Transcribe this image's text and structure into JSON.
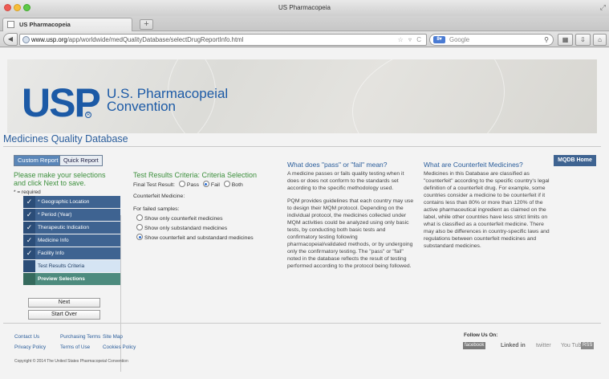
{
  "window": {
    "title": "US Pharmacopeia"
  },
  "tab": {
    "label": "US Pharmacopeia",
    "new_tab": "+"
  },
  "nav": {
    "url_host": "www.usp.org",
    "url_path": "/app/worldwide/medQualityDatabase/selectDrugReportInfo.html",
    "search_placeholder": "Google",
    "search_engine_icon": "google-icon"
  },
  "header": {
    "logo_text": "US",
    "logo_text_p": "P",
    "org_name_line1": "U.S. Pharmacopeial",
    "org_name_line2": "Convention",
    "db_title": "Medicines Quality Database"
  },
  "report_tabs": {
    "custom": "Custom Report",
    "quick": "Quick Report"
  },
  "left_panel": {
    "heading": "Please make your selections and click Next to save.",
    "required_note": "* = required",
    "steps": [
      {
        "label": "* Geographic Location",
        "checked": true
      },
      {
        "label": "* Period (Year)",
        "checked": true
      },
      {
        "label": "Therapeutic Indication",
        "checked": true
      },
      {
        "label": "Medicine Info",
        "checked": true
      },
      {
        "label": "Facility Info",
        "checked": true
      },
      {
        "label": "Test Results Criteria",
        "checked": false
      },
      {
        "label": "Preview Selections",
        "checked": false
      }
    ],
    "next_button": "Next",
    "start_over_button": "Start Over"
  },
  "criteria": {
    "title": "Test Results Criteria: Criteria Selection",
    "final_result_label": "Final Test Result:",
    "final_result_options": [
      "Pass",
      "Fail",
      "Both"
    ],
    "final_result_selected": "Fail",
    "counterfeit_label": "Counterfeit Medicine:",
    "failed_label": "For failed samples:",
    "sample_options": [
      "Show only counterfeit medicines",
      "Show only substandard medicines",
      "Show counterfeit and substandard medicines"
    ],
    "sample_selected": "Show counterfeit and substandard medicines"
  },
  "pass_fail": {
    "heading": "What does \"pass\" or \"fail\" mean?",
    "p1": "A medicine passes or fails quality testing when it does or does not conform to the standards set according to the specific methodology used.",
    "p2": "PQM provides guidelines that each country may use to design their MQM protocol. Depending on the individual protocol, the medicines collected under MQM activities could be analyzed using only basic tests, by conducting both basic tests and confirmatory testing following pharmacopeial/validated methods, or by undergoing only the confirmatory testing. The \"pass\" or \"fail\" noted in the database reflects the result of testing performed according to the protocol being followed."
  },
  "counterfeit": {
    "heading": "What are Counterfeit Medicines?",
    "p1": "Medicines in this Database are classified as \"counterfeit\" according to the specific country's legal definition of a counterfeit drug. For example, some countries consider a medicine to be counterfeit if it contains less than 80% or more than 120% of the active pharmaceutical ingredient as claimed on the label, while other countries have less strict limits on what is classified as a counterfeit medicine. There may also be differences in country-specific laws and regulations between counterfeit medicines and substandard medicines."
  },
  "mqdb_home": "MQDB Home",
  "footer": {
    "links_row1": [
      "Contact Us",
      "Purchasing Terms",
      "Site Map"
    ],
    "links_row2": [
      "Privacy Policy",
      "Terms of Use",
      "Cookies Policy"
    ],
    "copyright": "Copyright © 2014 The United States Pharmacopeial Convention",
    "follow_us": "Follow Us On:",
    "social": {
      "facebook": "facebook",
      "linkedin": "Linked in",
      "twitter": "twitter",
      "youtube": "You Tube",
      "rss": "RSS"
    }
  }
}
